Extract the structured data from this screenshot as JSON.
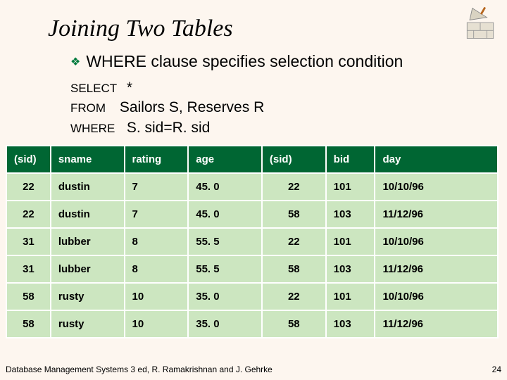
{
  "title": "Joining Two Tables",
  "bullet": "WHERE clause specifies selection condition",
  "sql": {
    "select_kw": "SELECT",
    "select_val": "*",
    "from_kw": "FROM",
    "from_val": "Sailors S, Reserves R",
    "where_kw": "WHERE",
    "where_val": "S. sid=R. sid"
  },
  "table": {
    "headers": [
      "(sid)",
      "sname",
      "rating",
      "age",
      "(sid)",
      "bid",
      "day"
    ],
    "rows": [
      [
        "22",
        "dustin",
        "7",
        "45. 0",
        "22",
        "101",
        "10/10/96"
      ],
      [
        "22",
        "dustin",
        "7",
        "45. 0",
        "58",
        "103",
        "11/12/96"
      ],
      [
        "31",
        "lubber",
        "8",
        "55. 5",
        "22",
        "101",
        "10/10/96"
      ],
      [
        "31",
        "lubber",
        "8",
        "55. 5",
        "58",
        "103",
        "11/12/96"
      ],
      [
        "58",
        "rusty",
        "10",
        "35. 0",
        "22",
        "101",
        "10/10/96"
      ],
      [
        "58",
        "rusty",
        "10",
        "35. 0",
        "58",
        "103",
        "11/12/96"
      ]
    ]
  },
  "footer": {
    "credit": "Database Management Systems 3 ed, R. Ramakrishnan and J. Gehrke",
    "page": "24"
  },
  "icon": "brick-trowel-icon"
}
